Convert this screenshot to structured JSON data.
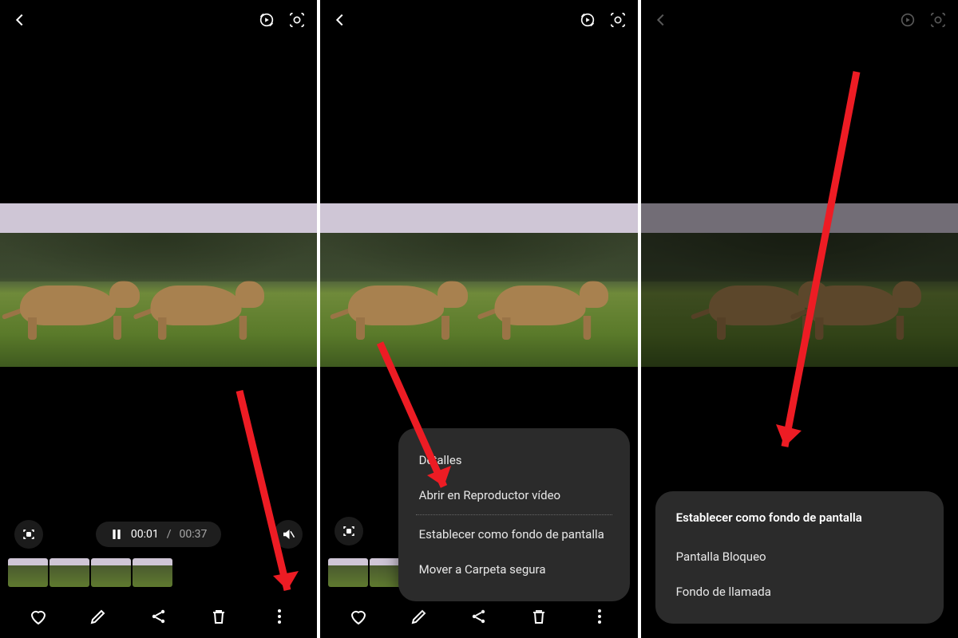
{
  "playback": {
    "current_time": "00:01",
    "separator": "/",
    "total_time": "00:37"
  },
  "menu": {
    "details": "Detalles",
    "open_player": "Abrir en Reproductor vídeo",
    "set_wallpaper": "Establecer como fondo de pantalla",
    "move_secure": "Mover a Carpeta segura"
  },
  "wallpaper_dialog": {
    "title": "Establecer como fondo de pantalla",
    "lock_screen": "Pantalla Bloqueo",
    "call_background": "Fondo de llamada"
  }
}
